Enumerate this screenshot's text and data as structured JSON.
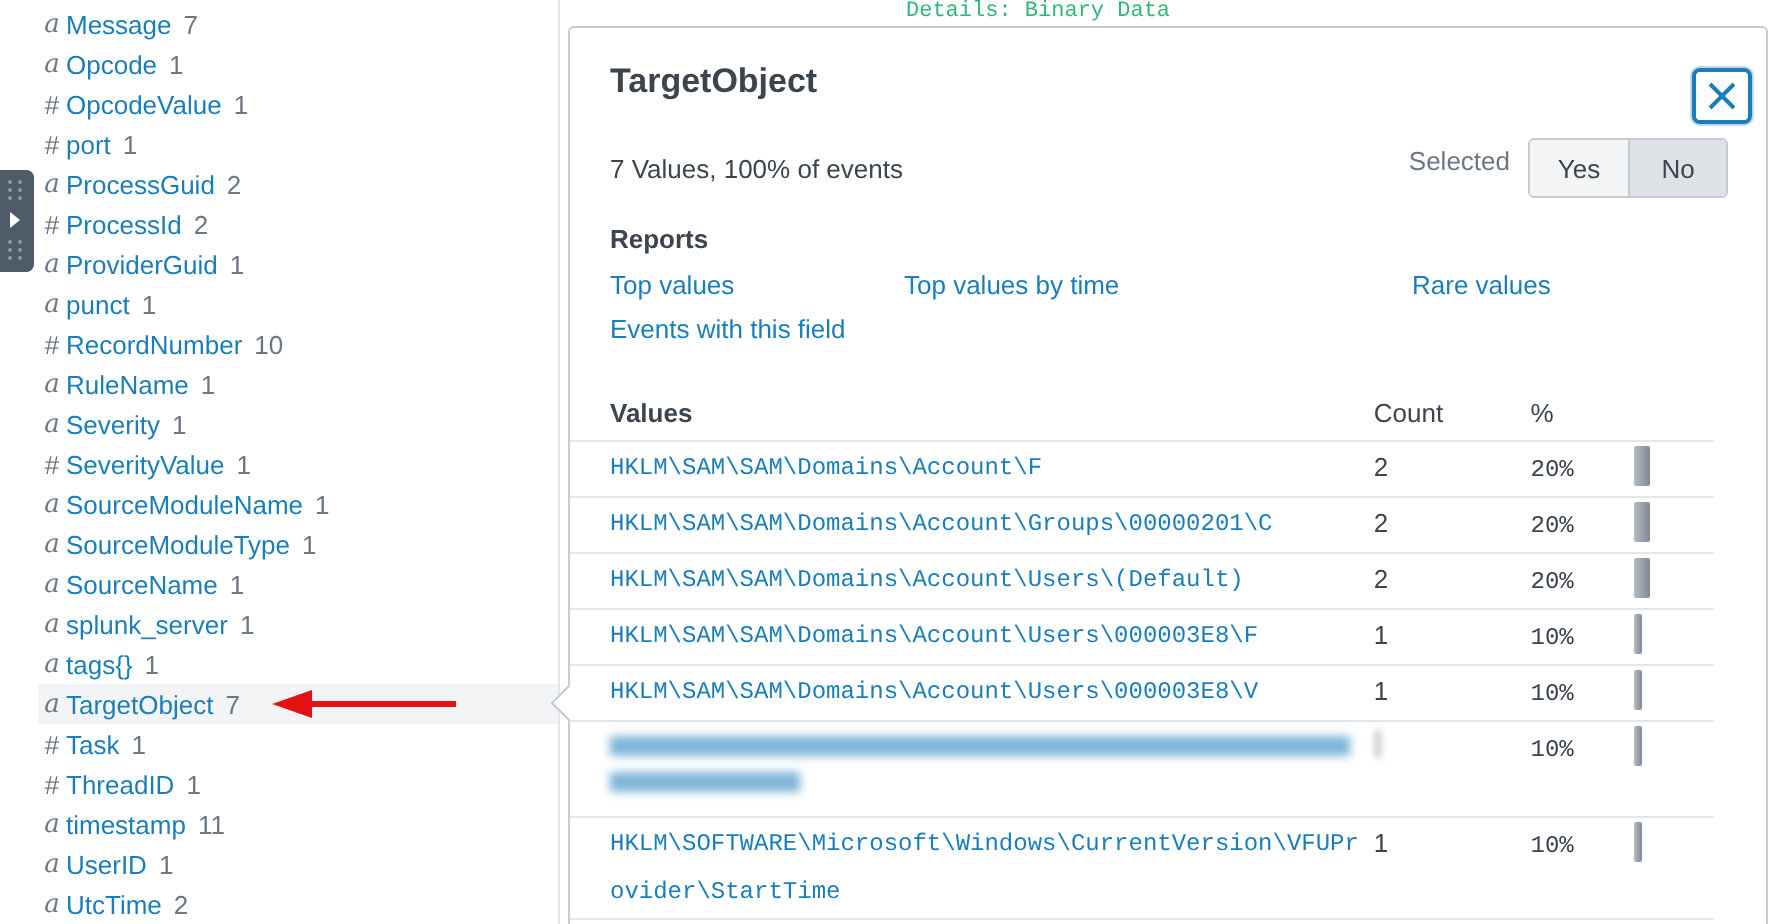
{
  "sidebar": {
    "fields": [
      {
        "glyph": "a",
        "name": "Message",
        "count": "7",
        "selected": false,
        "arrow": false
      },
      {
        "glyph": "a",
        "name": "Opcode",
        "count": "1",
        "selected": false,
        "arrow": false
      },
      {
        "glyph": "#",
        "name": "OpcodeValue",
        "count": "1",
        "selected": false,
        "arrow": false
      },
      {
        "glyph": "#",
        "name": "port",
        "count": "1",
        "selected": false,
        "arrow": false
      },
      {
        "glyph": "a",
        "name": "ProcessGuid",
        "count": "2",
        "selected": false,
        "arrow": false
      },
      {
        "glyph": "#",
        "name": "ProcessId",
        "count": "2",
        "selected": false,
        "arrow": false
      },
      {
        "glyph": "a",
        "name": "ProviderGuid",
        "count": "1",
        "selected": false,
        "arrow": false
      },
      {
        "glyph": "a",
        "name": "punct",
        "count": "1",
        "selected": false,
        "arrow": false
      },
      {
        "glyph": "#",
        "name": "RecordNumber",
        "count": "10",
        "selected": false,
        "arrow": false
      },
      {
        "glyph": "a",
        "name": "RuleName",
        "count": "1",
        "selected": false,
        "arrow": false
      },
      {
        "glyph": "a",
        "name": "Severity",
        "count": "1",
        "selected": false,
        "arrow": false
      },
      {
        "glyph": "#",
        "name": "SeverityValue",
        "count": "1",
        "selected": false,
        "arrow": false
      },
      {
        "glyph": "a",
        "name": "SourceModuleName",
        "count": "1",
        "selected": false,
        "arrow": false
      },
      {
        "glyph": "a",
        "name": "SourceModuleType",
        "count": "1",
        "selected": false,
        "arrow": false
      },
      {
        "glyph": "a",
        "name": "SourceName",
        "count": "1",
        "selected": false,
        "arrow": false
      },
      {
        "glyph": "a",
        "name": "splunk_server",
        "count": "1",
        "selected": false,
        "arrow": false
      },
      {
        "glyph": "a",
        "name": "tags{}",
        "count": "1",
        "selected": false,
        "arrow": false
      },
      {
        "glyph": "a",
        "name": "TargetObject",
        "count": "7",
        "selected": true,
        "arrow": true
      },
      {
        "glyph": "#",
        "name": "Task",
        "count": "1",
        "selected": false,
        "arrow": false
      },
      {
        "glyph": "#",
        "name": "ThreadID",
        "count": "1",
        "selected": false,
        "arrow": false
      },
      {
        "glyph": "a",
        "name": "timestamp",
        "count": "11",
        "selected": false,
        "arrow": false
      },
      {
        "glyph": "a",
        "name": "UserID",
        "count": "1",
        "selected": false,
        "arrow": false
      },
      {
        "glyph": "a",
        "name": "UtcTime",
        "count": "2",
        "selected": false,
        "arrow": false
      }
    ]
  },
  "background_text": "Details: Binary Data",
  "popup": {
    "title": "TargetObject",
    "summary": "7 Values, 100% of events",
    "selected_label": "Selected",
    "toggle": [
      {
        "label": "Yes",
        "selected": false
      },
      {
        "label": "No",
        "selected": true
      }
    ],
    "reports_heading": "Reports",
    "reports": [
      "Top values",
      "Top values by time",
      "Rare values",
      "Events with this field"
    ],
    "table": {
      "columns": [
        "Values",
        "Count",
        "%"
      ],
      "rows": [
        {
          "kind": "value",
          "value": "HKLM\\SAM\\SAM\\Domains\\Account\\F",
          "count": "2",
          "percent": "20%",
          "level": 0.2
        },
        {
          "kind": "value",
          "value": "HKLM\\SAM\\SAM\\Domains\\Account\\Groups\\00000201\\C",
          "count": "2",
          "percent": "20%",
          "level": 0.2
        },
        {
          "kind": "value",
          "value": "HKLM\\SAM\\SAM\\Domains\\Account\\Users\\(Default)",
          "count": "2",
          "percent": "20%",
          "level": 0.2
        },
        {
          "kind": "value",
          "value": "HKLM\\SAM\\SAM\\Domains\\Account\\Users\\000003E8\\F",
          "count": "1",
          "percent": "10%",
          "level": 0.1
        },
        {
          "kind": "value",
          "value": "HKLM\\SAM\\SAM\\Domains\\Account\\Users\\000003E8\\V",
          "count": "1",
          "percent": "10%",
          "level": 0.1
        },
        {
          "kind": "redacted",
          "percent": "10%",
          "level": 0.1
        },
        {
          "kind": "value",
          "value": "HKLM\\SOFTWARE\\Microsoft\\Windows\\CurrentVersion\\VFUProvider\\StartTime",
          "count": "1",
          "percent": "10%",
          "level": 0.1
        }
      ]
    }
  }
}
